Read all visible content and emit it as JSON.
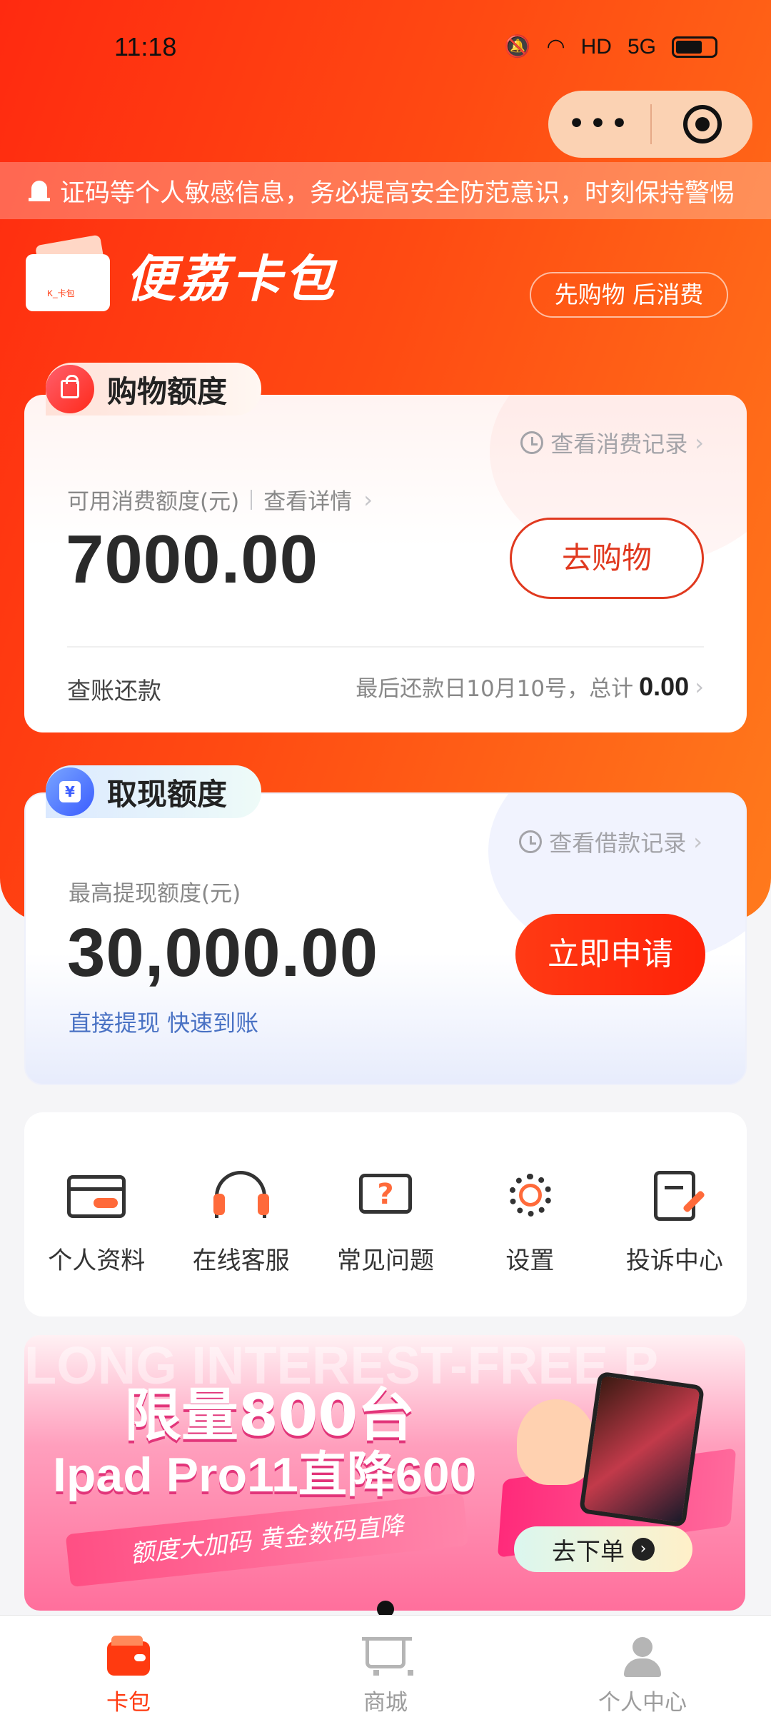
{
  "status_bar": {
    "time": "11:18",
    "indicators": [
      "mute-icon",
      "wifi-icon",
      "HD",
      "5G",
      "battery-icon"
    ]
  },
  "capsule": {
    "more": "•••"
  },
  "notice": {
    "text": "证码等个人敏感信息，务必提高安全防范意识，时刻保持警惕"
  },
  "brand": {
    "name": "便荔卡包",
    "logo_text": "K_卡包",
    "slogan": "先购物 后消费"
  },
  "shopping": {
    "tag": "购物额度",
    "record_link": "查看消费记录",
    "label": "可用消费额度(元)",
    "detail_link": "查看详情",
    "amount": "7000.00",
    "button": "去购物",
    "repay_label": "查账还款",
    "repay_info": "最后还款日10月10号，总计",
    "repay_total": "0.00"
  },
  "cash": {
    "tag": "取现额度",
    "record_link": "查看借款记录",
    "label": "最高提现额度(元)",
    "amount": "30,000.00",
    "button": "立即申请",
    "subtitle": "直接提现 快速到账"
  },
  "menu": [
    {
      "icon": "card-icon",
      "label": "个人资料"
    },
    {
      "icon": "headset-icon",
      "label": "在线客服"
    },
    {
      "icon": "question-icon",
      "label": "常见问题"
    },
    {
      "icon": "gear-icon",
      "label": "设置"
    },
    {
      "icon": "complaint-icon",
      "label": "投诉中心"
    }
  ],
  "banner": {
    "bg_text": "LONG INTEREST-FREE P",
    "headline": "限量800台",
    "subline": "Ipad Pro11直降600",
    "ribbon": "额度大加码 黄金数码直降",
    "cta": "去下单"
  },
  "tabbar": [
    {
      "icon": "wallet-icon",
      "label": "卡包",
      "active": true
    },
    {
      "icon": "cart-icon",
      "label": "商城",
      "active": false
    },
    {
      "icon": "person-icon",
      "label": "个人中心",
      "active": false
    }
  ],
  "colors": {
    "primary": "#ff3a10",
    "accent": "#ff6a3a",
    "link": "#4a72c4"
  }
}
